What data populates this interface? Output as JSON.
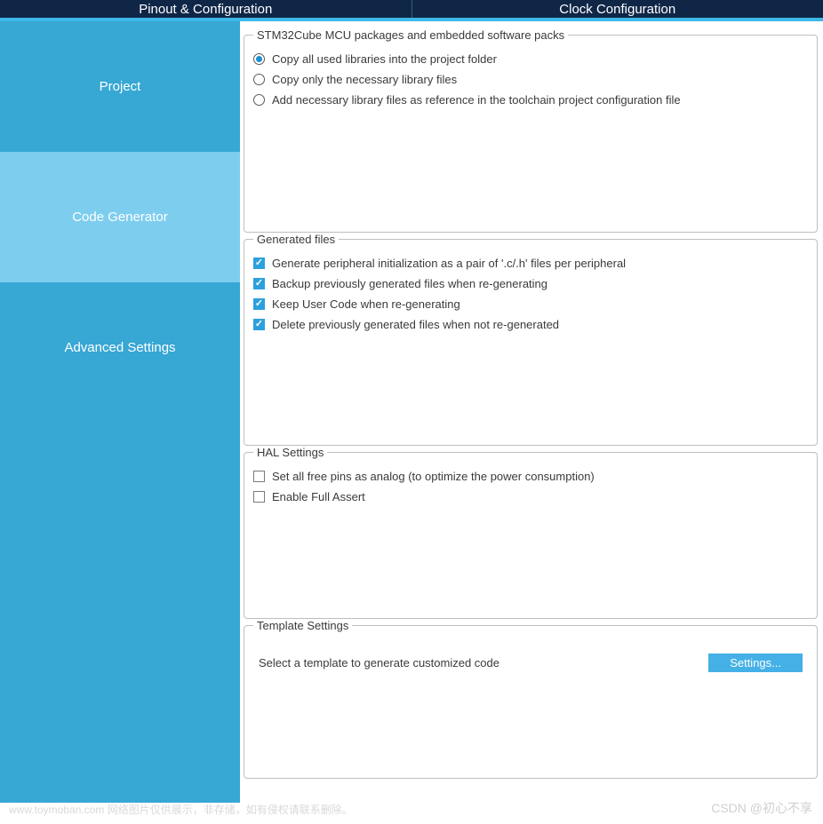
{
  "topTabs": {
    "pinout": "Pinout & Configuration",
    "clock": "Clock Configuration"
  },
  "sidebar": {
    "project": "Project",
    "codegen": "Code Generator",
    "advanced": "Advanced Settings"
  },
  "mcuPackages": {
    "legend": "STM32Cube MCU packages and embedded software packs",
    "opt1": "Copy all used libraries into the project folder",
    "opt2": "Copy only the necessary library files",
    "opt3": "Add necessary library files as reference in the toolchain project configuration file"
  },
  "generatedFiles": {
    "legend": "Generated files",
    "opt1": "Generate peripheral initialization as a pair of '.c/.h' files per peripheral",
    "opt2": "Backup previously generated files when re-generating",
    "opt3": "Keep User Code when re-generating",
    "opt4": "Delete previously generated files when not re-generated"
  },
  "halSettings": {
    "legend": "HAL Settings",
    "opt1": "Set all free pins as analog (to optimize the power consumption)",
    "opt2": "Enable Full Assert"
  },
  "templateSettings": {
    "legend": "Template Settings",
    "text": "Select a template to generate customized code",
    "button": "Settings..."
  },
  "watermark": {
    "left": "www.toymoban.com 网络图片仅供展示，非存储，如有侵权请联系删除。",
    "right": "CSDN @初心不享"
  }
}
